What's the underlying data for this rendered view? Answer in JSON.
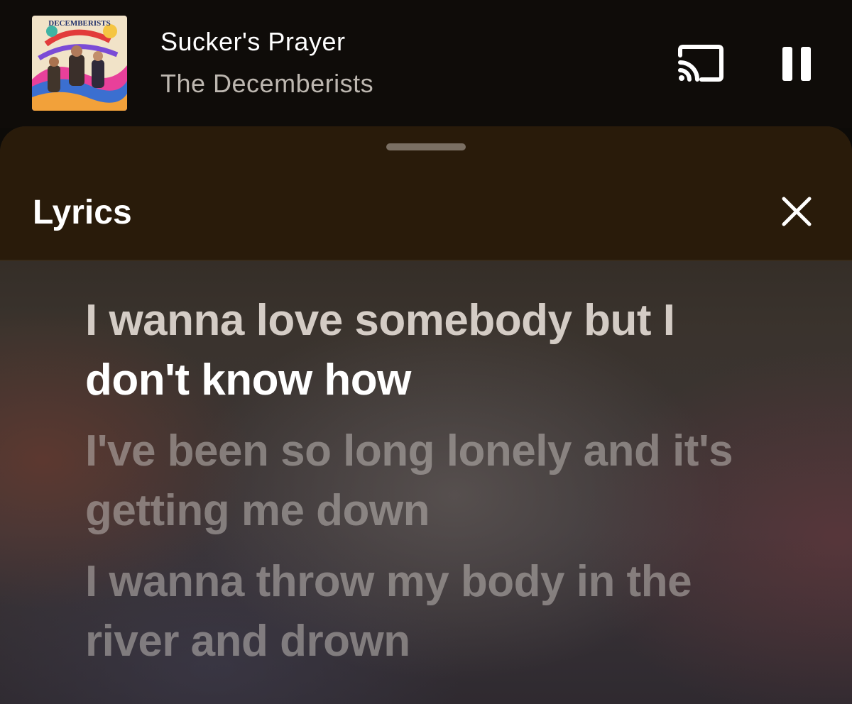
{
  "now_playing": {
    "title": "Sucker's Prayer",
    "artist": "The Decemberists",
    "album_art_text": "DECEMBERISTS",
    "cast_icon": "cast-icon",
    "pause_icon": "pause-icon"
  },
  "lyrics_sheet": {
    "title": "Lyrics",
    "close_icon": "close-icon",
    "lines": [
      {
        "sung": "I wanna love somebody but I ",
        "current": "don't know how",
        "state": "active"
      },
      {
        "text": "I've been so long lonely and it's getting me down",
        "state": "upcoming"
      },
      {
        "text": "I wanna throw my body in the river and drown",
        "state": "upcoming"
      }
    ]
  },
  "colors": {
    "header_bg": "#291b0a",
    "active_lyric": "#ffffff",
    "sung_lyric": "#d4ccc5",
    "upcoming_lyric": "#8c8683"
  }
}
